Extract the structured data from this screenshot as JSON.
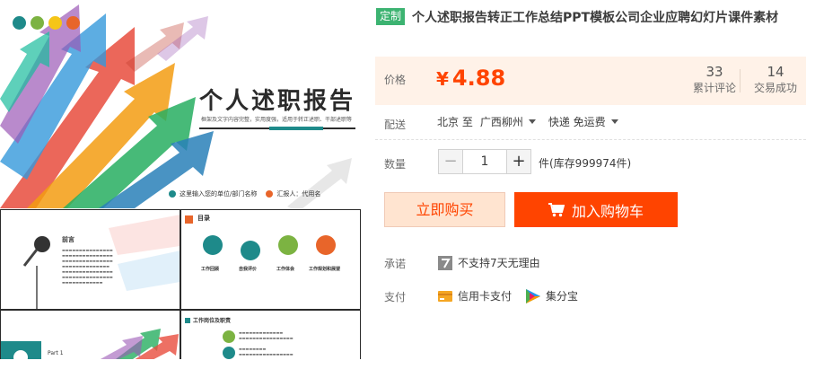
{
  "product": {
    "tag": "定制",
    "title": "个人述职报告转正工作总结PPT模板公司企业应聘幻灯片课件素材"
  },
  "price": {
    "label": "价格",
    "currency": "¥",
    "value": "4.88",
    "reviews_count": "33",
    "reviews_label": "累计评论",
    "trades_count": "14",
    "trades_label": "交易成功"
  },
  "shipping": {
    "label": "配送",
    "from": "北京 至",
    "to": "广西柳州",
    "method": "快递 免运费"
  },
  "quantity": {
    "label": "数量",
    "minus": "−",
    "value": "1",
    "plus": "+",
    "stock": "件(库存999974件)"
  },
  "actions": {
    "buy_now": "立即购买",
    "add_to_cart": "加入购物车"
  },
  "promise": {
    "label": "承诺",
    "text": "不支持7天无理由"
  },
  "payment": {
    "label": "支付",
    "methods": [
      "信用卡支付",
      "集分宝"
    ]
  },
  "preview": {
    "cover_title": "个人述职报告",
    "cover_subtitle": "框架及文字内容完整，实用度强，适用于转正述职、干部述职等",
    "cover_unit": "这里输入您的单位/部门名称",
    "cover_reporter": "汇报人：代用名",
    "slide1_heading": "前言",
    "slide2_heading": "目录",
    "slide2_items": [
      "工作回顾",
      "自我评价",
      "工作体会",
      "工作规划和展望"
    ],
    "slide3_heading": "Part 1",
    "slide4_heading": "工作岗位及职责"
  },
  "colors": {
    "accent": "#ff4400",
    "price_panel_bg": "#fff2e8",
    "custom_tag": "#3cb371"
  }
}
